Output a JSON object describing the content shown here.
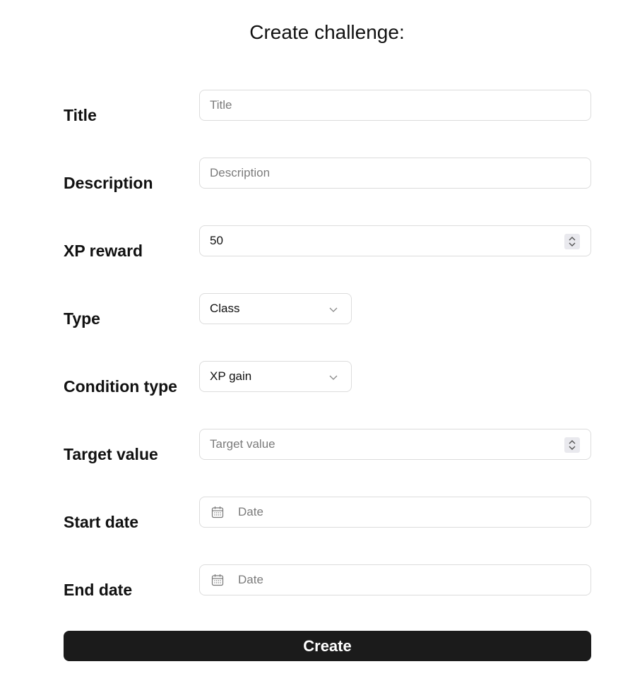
{
  "page_title": "Create challenge:",
  "fields": {
    "title": {
      "label": "Title",
      "placeholder": "Title"
    },
    "description": {
      "label": "Description",
      "placeholder": "Description"
    },
    "xp_reward": {
      "label": "XP reward",
      "value": "50"
    },
    "type": {
      "label": "Type",
      "selected": "Class"
    },
    "condition_type": {
      "label": "Condition type",
      "selected": "XP gain"
    },
    "target_value": {
      "label": "Target value",
      "placeholder": "Target value"
    },
    "start_date": {
      "label": "Start date",
      "placeholder": "Date"
    },
    "end_date": {
      "label": "End date",
      "placeholder": "Date"
    }
  },
  "actions": {
    "create_label": "Create"
  },
  "icons": {
    "stepper": "up-down-stepper-icon",
    "dropdown": "chevron-down-icon",
    "calendar": "calendar-icon"
  },
  "colors": {
    "button_bg": "#1b1b1b",
    "button_text": "#ffffff",
    "border": "#dcdcdc",
    "placeholder": "#7b7b7b"
  }
}
